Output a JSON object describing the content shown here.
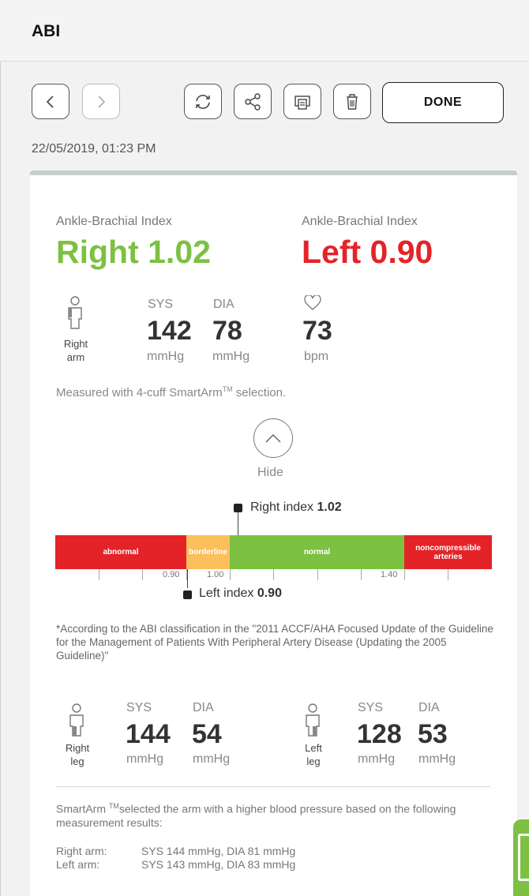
{
  "app": {
    "title": "ABI"
  },
  "toolbar": {
    "prev_icon": "chevron-left-icon",
    "next_icon": "chevron-right-icon",
    "sync_icon": "sync-icon",
    "share_icon": "share-icon",
    "print_icon": "print-icon",
    "delete_icon": "trash-icon",
    "done_label": "DONE"
  },
  "record": {
    "datetime": "22/05/2019, 01:23 PM"
  },
  "abi": {
    "right": {
      "caption": "Ankle-Brachial Index",
      "value_text": "Right 1.02",
      "color": "#7cc142"
    },
    "left": {
      "caption": "Ankle-Brachial Index",
      "value_text": "Left 0.90",
      "color": "#e42328"
    }
  },
  "arm_reading": {
    "limb_line1": "Right",
    "limb_line2": "arm",
    "sys_label": "SYS",
    "dia_label": "DIA",
    "sys": "142",
    "dia": "78",
    "unit": "mmHg",
    "pulse_icon": "heart-icon",
    "pulse": "73",
    "pulse_unit": "bpm"
  },
  "measured": {
    "text": "Measured with 4-cuff SmartArm",
    "tm": "TM",
    "suffix": " selection."
  },
  "toggle": {
    "icon": "chevron-up-icon",
    "label": "Hide"
  },
  "scale": {
    "right_marker_prefix": "Right index ",
    "right_marker_value": "1.02",
    "left_marker_prefix": "Left index ",
    "left_marker_value": "0.90",
    "segments": [
      {
        "label": "abnormal",
        "color": "#e42328"
      },
      {
        "label": "borderline",
        "color": "#fbbf5b"
      },
      {
        "label": "normal",
        "color": "#7cc142"
      },
      {
        "label": "noncompressible arteries",
        "color": "#e42328"
      }
    ],
    "tick_labels": [
      "0.90",
      "1.00",
      "1.40"
    ]
  },
  "footnote": "*According to the ABI classification in the \"2011 ACCF/AHA Focused Update of the Guideline for the Management of Patients With Peripheral Artery Disease (Updating the 2005 Guideline)\"",
  "leg_readings": {
    "right": {
      "limb_line1": "Right",
      "limb_line2": "leg",
      "sys": "144",
      "dia": "54"
    },
    "left": {
      "limb_line1": "Left",
      "limb_line2": "leg",
      "sys": "128",
      "dia": "53"
    },
    "sys_label": "SYS",
    "dia_label": "DIA",
    "unit": "mmHg"
  },
  "smartarm": {
    "prefix": "SmartArm ",
    "tm": "TM",
    "text": "selected the arm with a higher blood pressure based on the following measurement results:",
    "right_arm_label": "Right arm:",
    "right_arm_value": "SYS 144 mmHg, DIA 81 mmHg",
    "left_arm_label": "Left arm:",
    "left_arm_value": "SYS 143 mmHg, DIA 83 mmHg"
  }
}
